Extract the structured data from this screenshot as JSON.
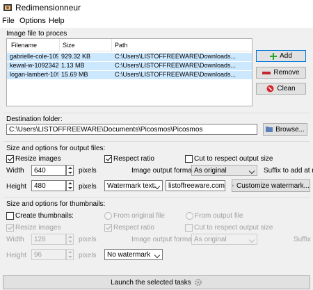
{
  "window": {
    "title": "Redimensionneur"
  },
  "menu": {
    "file": "File",
    "options": "Options",
    "help": "Help"
  },
  "files_group": {
    "label": "Image file to proces",
    "columns": {
      "filename": "Filename",
      "size": "Size",
      "path": "Path"
    },
    "rows": [
      {
        "filename": "gabrielle-cole-109",
        "size": "929.32 KB",
        "path": "C:\\Users\\LISTOFFREEWARE\\Downloads..."
      },
      {
        "filename": "kewal-w-1092342-",
        "size": "1.13 MB",
        "path": "C:\\Users\\LISTOFFREEWARE\\Downloads..."
      },
      {
        "filename": "logan-lambert-109",
        "size": "15.69 MB",
        "path": "C:\\Users\\LISTOFFREEWARE\\Downloads..."
      }
    ],
    "add_label": "Add",
    "remove_label": "Remove",
    "clean_label": "Clean"
  },
  "destination": {
    "label": "Destination folder:",
    "path": "C:\\Users\\LISTOFFREEWARE\\Documents\\Picosmos\\Picosmos",
    "browse_label": "Browse..."
  },
  "output": {
    "label": "Size and options for output files:",
    "resize_label": "Resize images",
    "resize_checked": true,
    "respect_label": "Respect ratio",
    "respect_checked": true,
    "cut_label": "Cut to respect output size",
    "cut_checked": false,
    "width_label": "Width",
    "width_value": "640",
    "height_label": "Height",
    "height_value": "480",
    "pixels": "pixels",
    "format_label": "Image output format:",
    "format_value": "As original",
    "suffix_label": "Suffix to add at nam",
    "watermark_select": "Watermark text:",
    "watermark_text": "listoffreeware.com",
    "customize_label": "Customize watermark..."
  },
  "thumbs": {
    "label": "Size and options for thumbnails:",
    "create_label": "Create thumbnails:",
    "create_checked": false,
    "from_original": "From original file",
    "from_output": "From output file",
    "resize_label": "Resize images",
    "respect_label": "Respect ratio",
    "cut_label": "Cut to respect output size",
    "width_label": "Width",
    "width_value": "128",
    "height_label": "Height",
    "height_value": "96",
    "pixels": "pixels",
    "format_label": "Image output format:",
    "format_value": "As original",
    "suffix_label": "Suffix t",
    "watermark_value": "No watermark"
  },
  "launch_label": "Launch the selected tasks"
}
